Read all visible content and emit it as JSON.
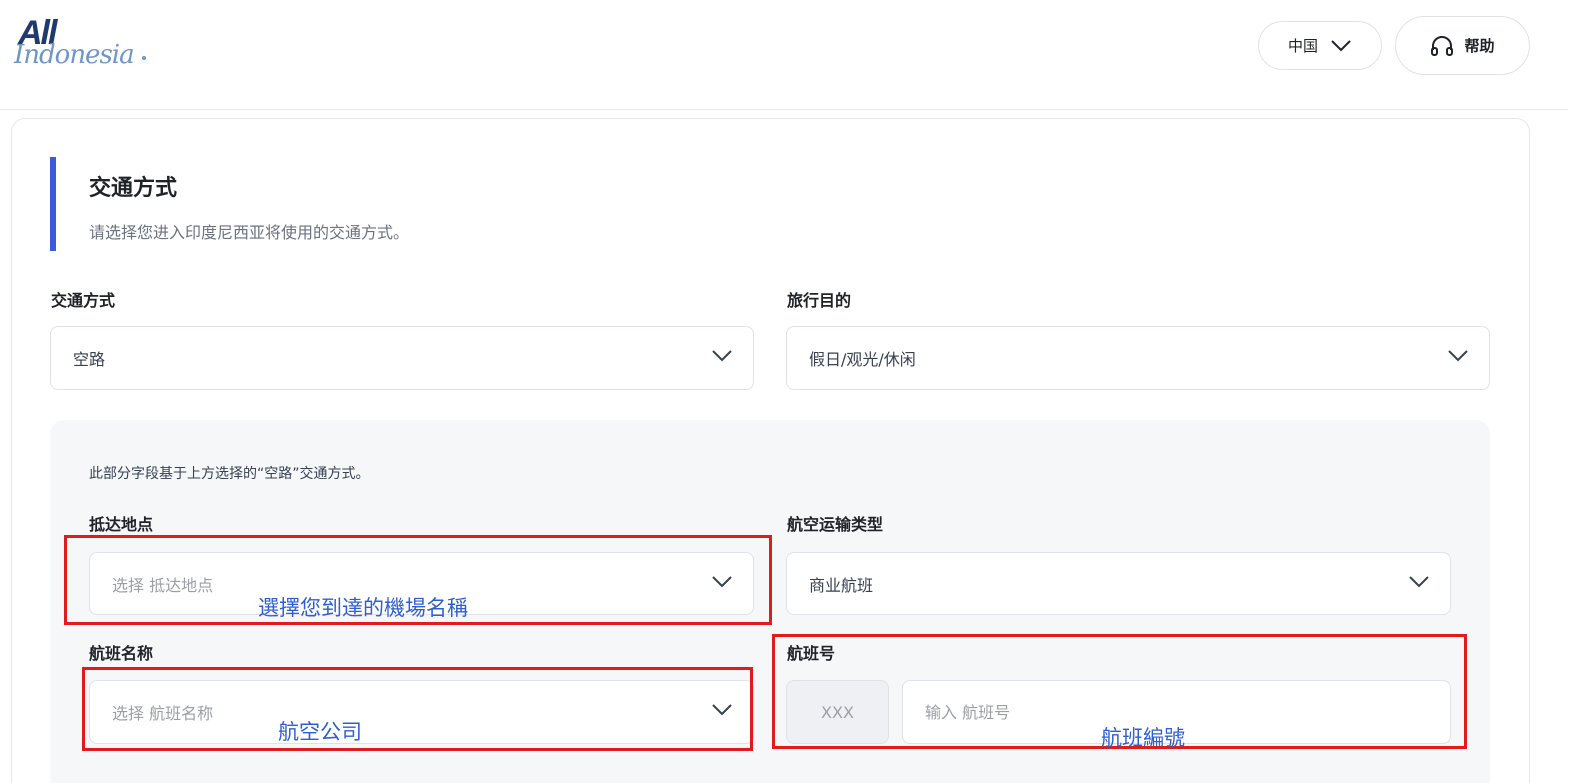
{
  "header": {
    "logo_all": "All",
    "logo_indonesia": "Indonesia",
    "language": "中国",
    "help": "帮助"
  },
  "section": {
    "title": "交通方式",
    "subtitle": "请选择您进入印度尼西亚将使用的交通方式。"
  },
  "fields": {
    "transport": {
      "label": "交通方式",
      "value": "空路"
    },
    "purpose": {
      "label": "旅行目的",
      "value": "假日/观光/休闲"
    }
  },
  "air_section": {
    "note": "此部分字段基于上方选择的“空路”交通方式。",
    "arrival": {
      "label": "抵达地点",
      "placeholder": "选择 抵达地点"
    },
    "transport_type": {
      "label": "航空运输类型",
      "value": "商业航班"
    },
    "flight_name": {
      "label": "航班名称",
      "placeholder": "选择 航班名称"
    },
    "flight_number": {
      "label": "航班号",
      "prefix": "XXX",
      "placeholder": "输入 航班号"
    }
  },
  "annotations": {
    "arrival_note": "選擇您到達的機場名稱",
    "airline_note": "航空公司",
    "flight_number_note": "航班編號"
  },
  "colors": {
    "accent": "#3b5bdb",
    "annotation_box": "#e01b1b",
    "annotation_text": "#2f5fcf"
  }
}
